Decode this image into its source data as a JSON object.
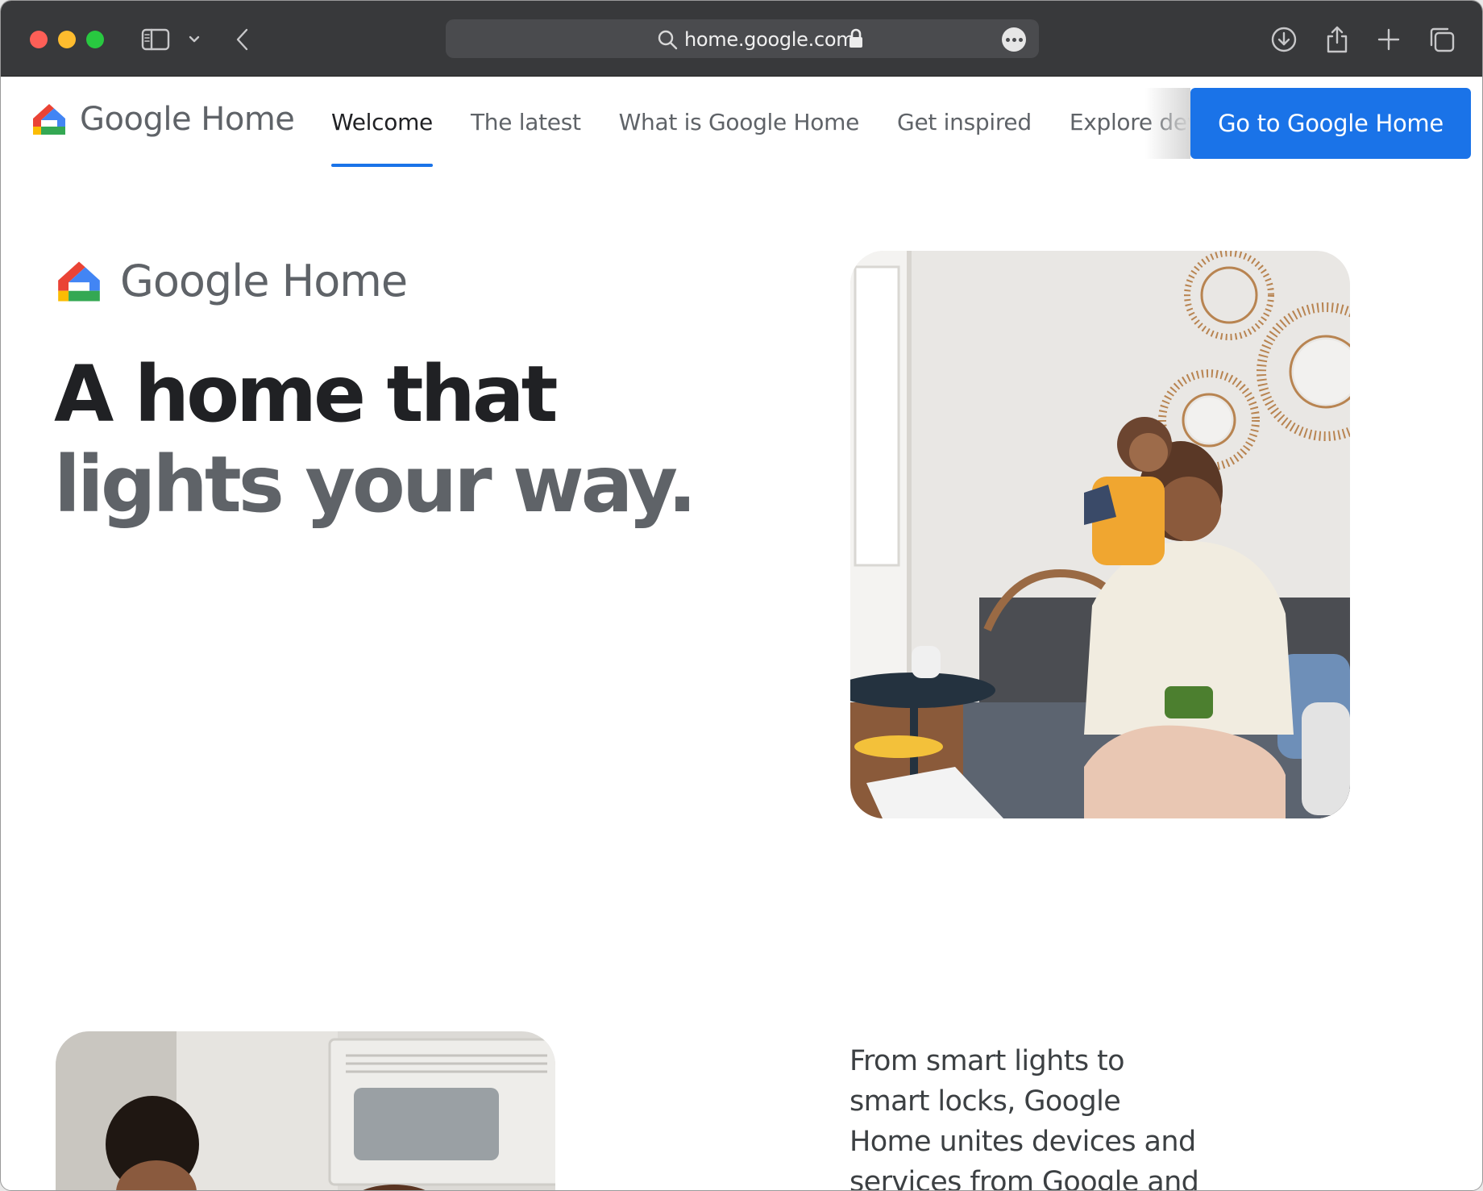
{
  "browser": {
    "url": "home.google.com"
  },
  "nav": {
    "brand": "Google Home",
    "brand_google": "Google",
    "brand_home": "Home",
    "tabs": [
      {
        "label": "Welcome",
        "active": true
      },
      {
        "label": "The latest",
        "active": false
      },
      {
        "label": "What is Google Home",
        "active": false
      },
      {
        "label": "Get inspired",
        "active": false
      },
      {
        "label": "Explore devi",
        "active": false
      }
    ],
    "cta_label": "Go to Google Home"
  },
  "hero": {
    "brand_google": "Google",
    "brand_home": "Home",
    "headline_line1": "A home that",
    "headline_line2": "lights your way."
  },
  "section2": {
    "body": "From smart lights to smart locks, Google Home unites devices and services from Google and your favorite"
  },
  "colors": {
    "accent": "#1a73e8",
    "chrome_bg": "#38393b",
    "text_dark": "#202124",
    "text_grey": "#5f6368"
  }
}
